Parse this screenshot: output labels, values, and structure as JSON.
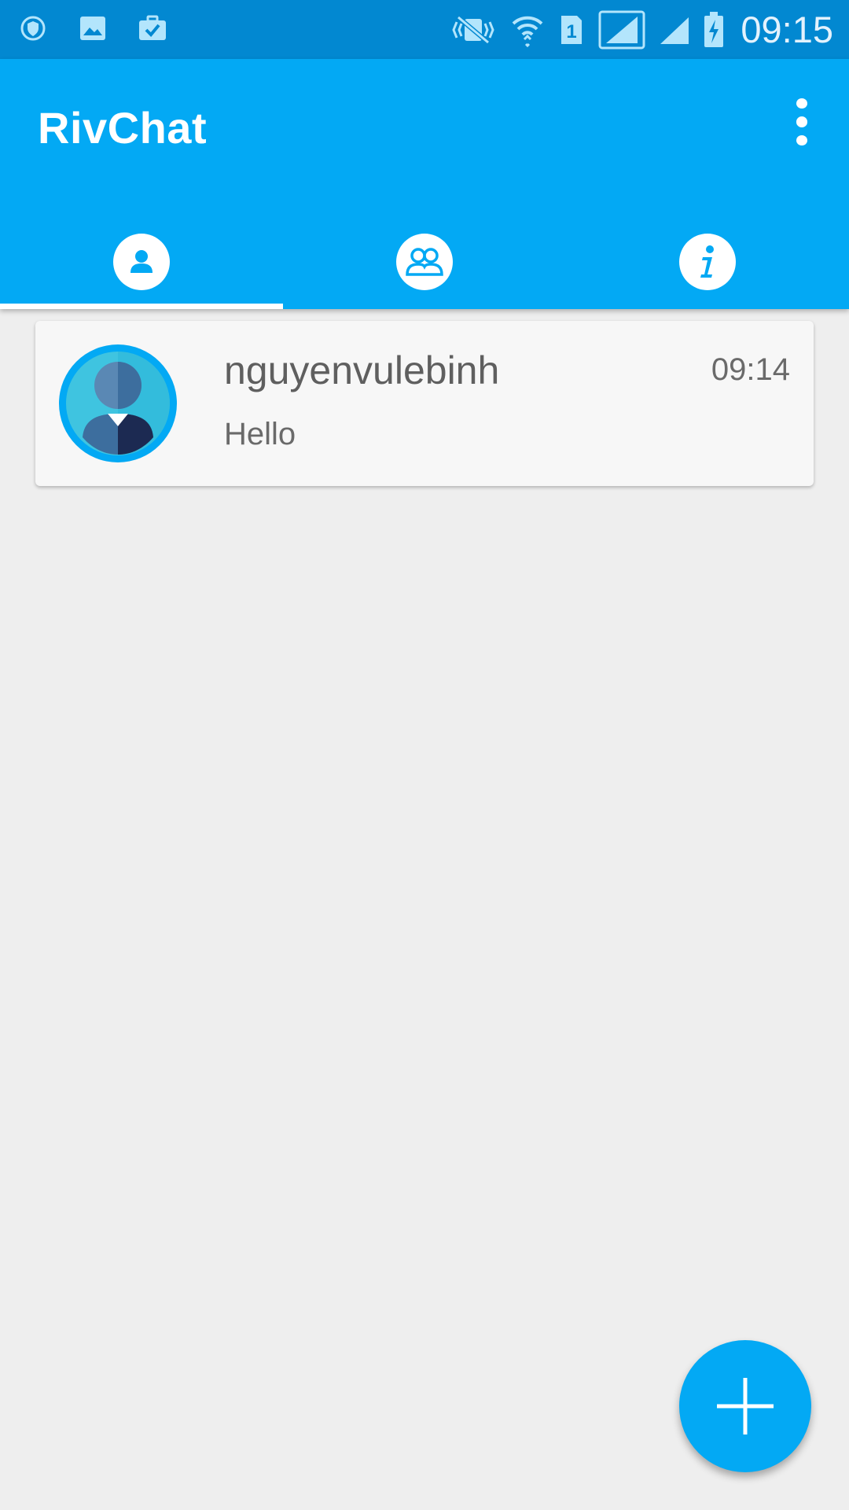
{
  "status_bar": {
    "time": "09:15",
    "left_icons": [
      "vpn-shield-icon",
      "image-icon",
      "briefcase-check-icon"
    ],
    "right_icons": [
      "vibrate-muted-icon",
      "wifi-icon",
      "sim-1-icon",
      "signal-full-icon",
      "signal-icon",
      "battery-charging-icon"
    ]
  },
  "app_bar": {
    "title": "RivChat",
    "tabs": [
      {
        "name": "friends",
        "icon": "person-icon",
        "selected": true
      },
      {
        "name": "groups",
        "icon": "group-icon",
        "selected": false
      },
      {
        "name": "info",
        "icon": "info-icon",
        "selected": false
      }
    ]
  },
  "conversations": [
    {
      "name": "nguyenvulebinh",
      "message": "Hello",
      "time": "09:14",
      "avatar": "default-avatar-icon"
    }
  ],
  "colors": {
    "primary": "#03a9f4",
    "primary_dark": "#0288d1",
    "background": "#eeeeee"
  },
  "fab": {
    "icon": "plus-icon"
  }
}
